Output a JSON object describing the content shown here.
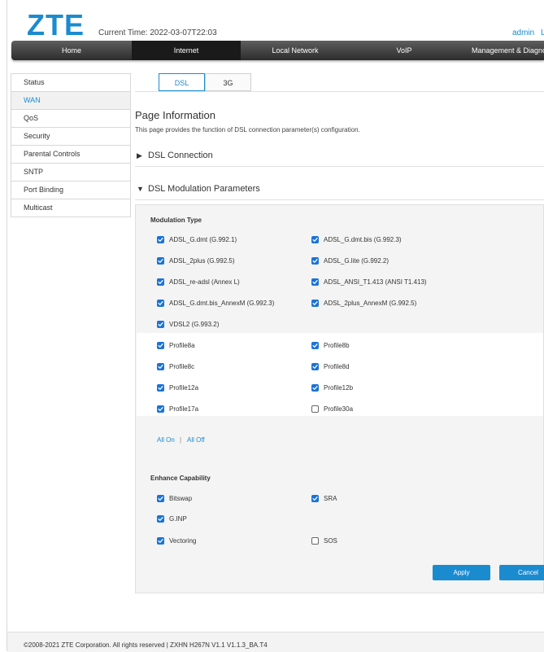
{
  "header": {
    "logo": "ZTE",
    "current_time_label": "Current Time:",
    "current_time": "2022-03-07T22:03",
    "user": "admin",
    "logout": "L"
  },
  "nav": {
    "items": [
      "Home",
      "Internet",
      "Local Network",
      "VoIP",
      "Management & Diagnos"
    ],
    "active": "Internet"
  },
  "sidebar": {
    "items": [
      "Status",
      "WAN",
      "QoS",
      "Security",
      "Parental Controls",
      "SNTP",
      "Port Binding",
      "Multicast"
    ],
    "active": "WAN"
  },
  "tabs": {
    "dsl": "DSL",
    "g3": "3G",
    "active": "DSL"
  },
  "page": {
    "title": "Page Information",
    "description": "This page provides the function of DSL connection parameter(s) configuration."
  },
  "sections": {
    "dsl_connection": "DSL Connection",
    "modulation_params": "DSL Modulation Parameters"
  },
  "modulation": {
    "heading": "Modulation Type",
    "items": [
      {
        "label": "ADSL_G.dmt (G.992.1)",
        "checked": true
      },
      {
        "label": "ADSL_G.dmt.bis (G.992.3)",
        "checked": true
      },
      {
        "label": "ADSL_2plus (G.992.5)",
        "checked": true
      },
      {
        "label": "ADSL_G.lite (G.992.2)",
        "checked": true
      },
      {
        "label": "ADSL_re-adsl (Annex L)",
        "checked": true
      },
      {
        "label": "ADSL_ANSI_T1.413 (ANSI T1.413)",
        "checked": true
      },
      {
        "label": "ADSL_G.dmt.bis_AnnexM (G.992.3)",
        "checked": true
      },
      {
        "label": "ADSL_2plus_AnnexM (G.992.5)",
        "checked": true
      },
      {
        "label": "VDSL2 (G.993.2)",
        "checked": true
      }
    ]
  },
  "profiles": {
    "items": [
      {
        "label": "Profile8a",
        "checked": true
      },
      {
        "label": "Profile8b",
        "checked": true
      },
      {
        "label": "Profile8c",
        "checked": true
      },
      {
        "label": "Profile8d",
        "checked": true
      },
      {
        "label": "Profile12a",
        "checked": true
      },
      {
        "label": "Profile12b",
        "checked": true
      },
      {
        "label": "Profile17a",
        "checked": true
      },
      {
        "label": "Profile30a",
        "checked": false
      }
    ],
    "all_on": "All On",
    "separator": "|",
    "all_off": "All Off"
  },
  "enhance": {
    "heading": "Enhance Capability",
    "items": [
      {
        "label": "Bitswap",
        "checked": true
      },
      {
        "label": "SRA",
        "checked": true
      },
      {
        "label": "G.INP",
        "checked": true
      },
      {
        "label": "Vectoring",
        "checked": true
      },
      {
        "label": "SOS",
        "checked": false
      }
    ]
  },
  "buttons": {
    "apply": "Apply",
    "cancel": "Cancel"
  },
  "footer": {
    "text": "©2008-2021 ZTE Corporation. All rights reserved  |  ZXHN H267N V1.1 V1.1.3_BA.T4"
  },
  "colors": {
    "accent": "#1b8bd0",
    "checkbox": "#1a73d9",
    "nav_bg": "#3a3a3a"
  }
}
